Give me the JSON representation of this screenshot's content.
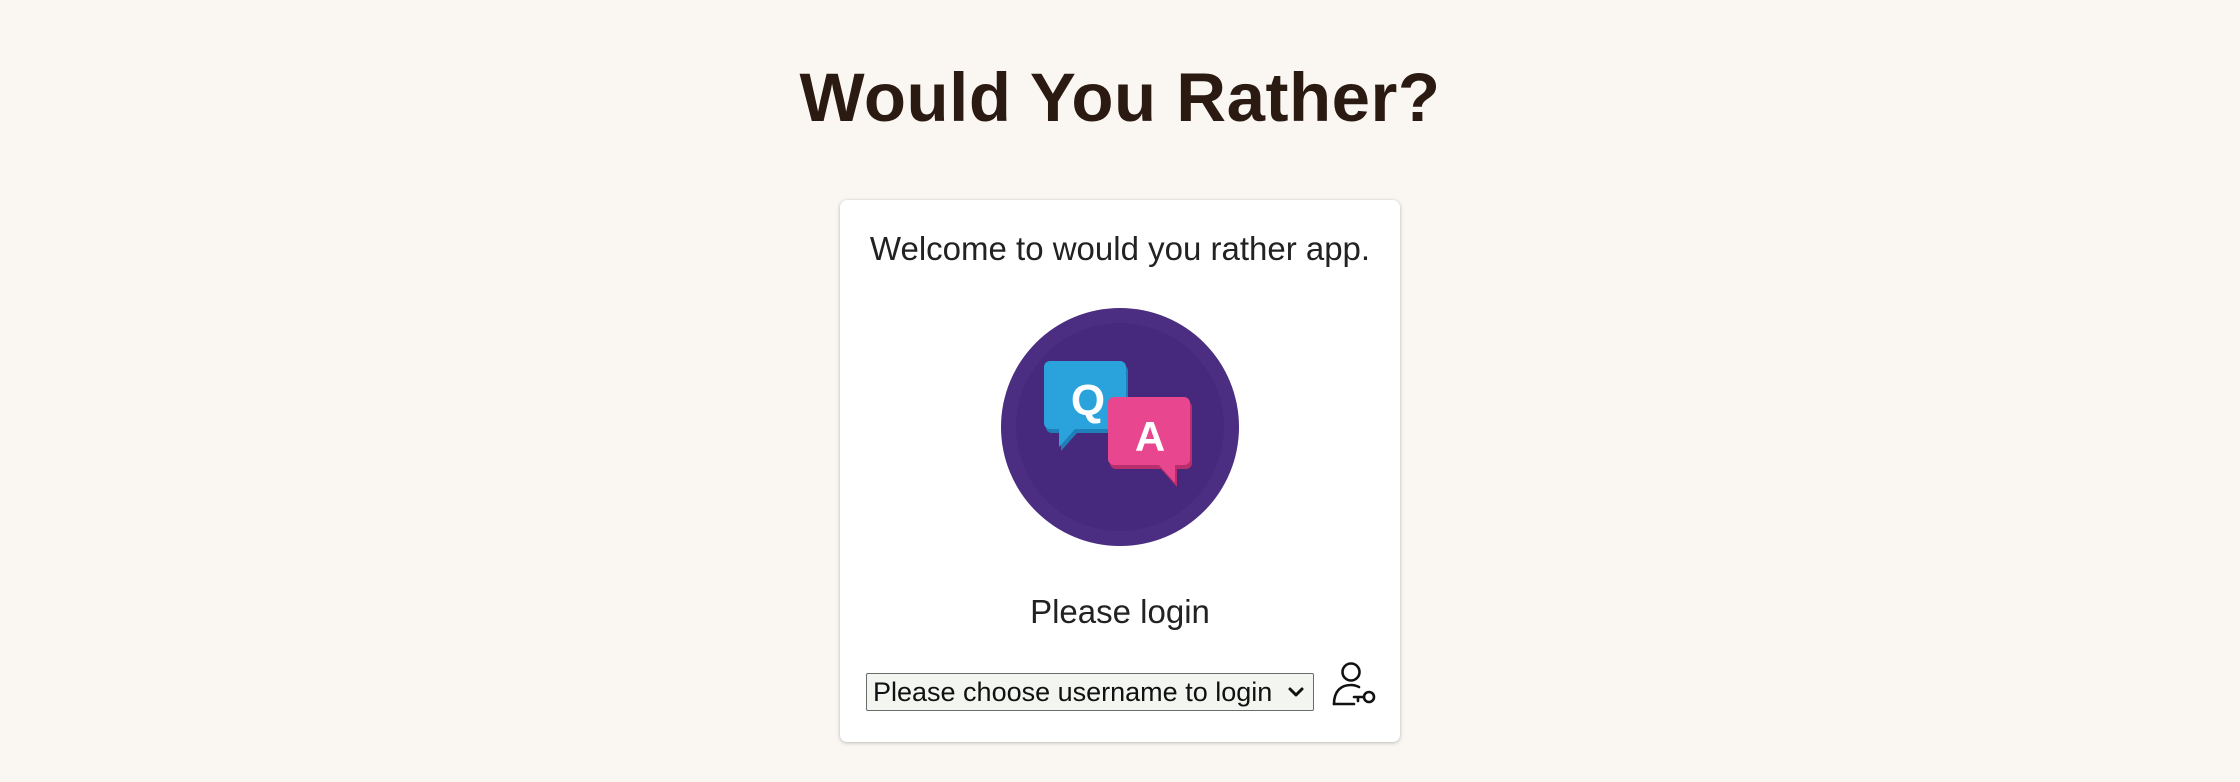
{
  "page": {
    "title": "Would You Rather?"
  },
  "login_card": {
    "welcome": "Welcome to would you rather app.",
    "logo": {
      "icon": "qa-chat-bubbles-icon",
      "question_letter": "Q",
      "answer_letter": "A",
      "colors": {
        "circle": "#4b2d82",
        "circle_inner": "#46297c",
        "question_bubble": "#2aa3dd",
        "answer_bubble": "#e8478f"
      }
    },
    "prompt": "Please login",
    "user_select": {
      "selected": "Please choose username to login"
    },
    "login_icon": "user-key-icon"
  }
}
